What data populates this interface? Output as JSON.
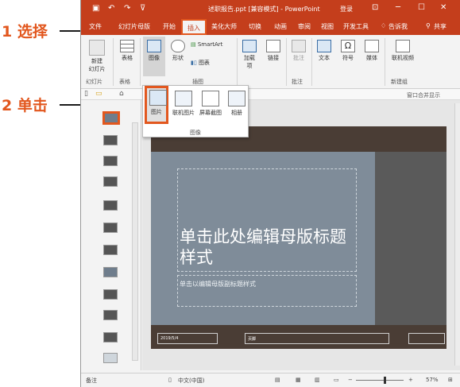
{
  "annotations": {
    "step1": "1 选择",
    "step2": "2 单击"
  },
  "titlebar": {
    "save_icon": "save-icon",
    "undo_icon": "undo-icon",
    "redo_icon": "redo-icon",
    "title": "述职报告.ppt [兼容模式] - PowerPoint",
    "signin": "登录"
  },
  "tabs": [
    {
      "label": "文件"
    },
    {
      "label": "幻灯片母版"
    },
    {
      "label": "开始"
    },
    {
      "label": "插入"
    },
    {
      "label": "美化大师"
    },
    {
      "label": "切换"
    },
    {
      "label": "动画"
    },
    {
      "label": "审阅"
    },
    {
      "label": "视图"
    },
    {
      "label": "开发工具"
    },
    {
      "label": "告诉我"
    },
    {
      "label": "共享"
    }
  ],
  "ribbon": {
    "new_slide": "新建\n幻灯片",
    "table": "表格",
    "image": "图像",
    "shapes": "形状",
    "smartart": "SmartArt",
    "chart": "图表",
    "addins": "加载\n项",
    "link": "链接",
    "comment": "批注",
    "text": "文本",
    "symbol": "符号",
    "media": "媒体",
    "screen_record": "联机视频",
    "groups": {
      "slides": "幻灯片",
      "tables": "表格",
      "images": "插图",
      "comments": "批注",
      "new_group": "新建组"
    }
  },
  "subbar": {
    "right": "窗口合并显示"
  },
  "dropdown": {
    "items": [
      {
        "label": "图片"
      },
      {
        "label": "联机图片"
      },
      {
        "label": "屏幕截图"
      },
      {
        "label": "相册"
      }
    ],
    "group": "图像"
  },
  "slide": {
    "title": "单击此处编辑母版标题样式",
    "subtitle": "单击以编辑母版副标题样式",
    "footer_date": "2019/5/4",
    "footer_mid": "页脚"
  },
  "status": {
    "notes": "备注",
    "lang": "中文(中国)",
    "zoom": "57%"
  }
}
